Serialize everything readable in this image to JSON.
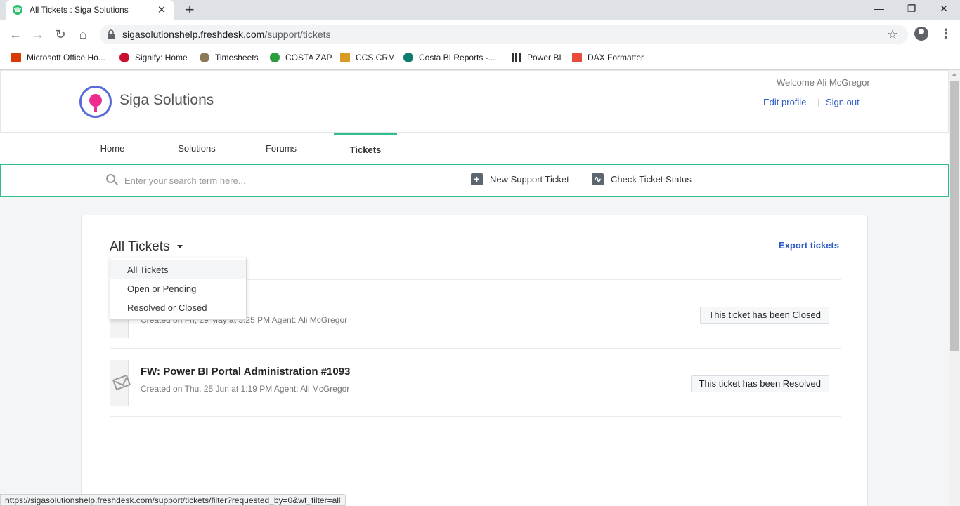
{
  "browser": {
    "tab_title": "All Tickets : Siga Solutions",
    "tab_close": "✕",
    "new_tab": "+",
    "url_domain": "sigasolutionshelp.freshdesk.com",
    "url_path": "/support/tickets",
    "status_url": "https://sigasolutionshelp.freshdesk.com/support/tickets/filter?requested_by=0&wf_filter=all",
    "window_controls": [
      "—",
      "❐",
      "✕"
    ],
    "nav_icons": [
      "←",
      "→",
      "↻",
      "⌂"
    ],
    "bookmarks": [
      {
        "label": "Microsoft Office Ho...",
        "color": "#d83b01"
      },
      {
        "label": "Signify: Home",
        "color": "#c8102e"
      },
      {
        "label": "Timesheets",
        "color": "#8a7a5a"
      },
      {
        "label": "COSTA ZAP",
        "color": "#2a9d3c"
      },
      {
        "label": "CCS CRM",
        "color": "#d89a20"
      },
      {
        "label": "Costa BI Reports -...",
        "color": "#0f7b6c"
      },
      {
        "label": "Power BI",
        "color": "#333333"
      },
      {
        "label": "DAX Formatter",
        "color": "#e74c3c"
      }
    ]
  },
  "header": {
    "brand": "Siga Solutions",
    "welcome": "Welcome Ali McGregor",
    "edit_profile": "Edit profile",
    "separator": "|",
    "sign_out": "Sign out"
  },
  "nav": {
    "items": [
      "Home",
      "Solutions",
      "Forums",
      "Tickets"
    ],
    "active": "Tickets"
  },
  "search": {
    "placeholder": "Enter your search term here...",
    "new_ticket": "New Support Ticket",
    "check_status": "Check Ticket Status"
  },
  "tickets": {
    "filter_label": "All Tickets",
    "export": "Export tickets",
    "filter_options": [
      "All Tickets",
      "Open or Pending",
      "Resolved or Closed"
    ],
    "rows": [
      {
        "title": "",
        "meta": "Created on Fri, 29 May at 3:25 PM Agent: Ali McGregor",
        "status": "This ticket has been Closed"
      },
      {
        "title": "FW: Power BI Portal Administration #1093",
        "meta": "Created on Thu, 25 Jun at 1:19 PM Agent: Ali McGregor",
        "status": "This ticket has been Resolved"
      }
    ]
  },
  "colors": {
    "accent": "#2ebd8e",
    "link": "#2c5cc5",
    "logo_ring": "#5a6ad6",
    "logo_bulb": "#ec2b8f"
  }
}
